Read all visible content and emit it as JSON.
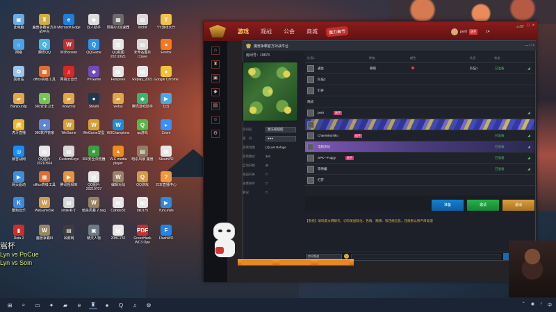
{
  "desktop": {
    "icons": [
      {
        "label": "此电脑",
        "glyph": "▣",
        "color": "#6ca9e7"
      },
      {
        "label": "魔兽争霸官方对战平台",
        "glyph": "♜",
        "color": "#d1ad40"
      },
      {
        "label": "Microsoft Edge",
        "glyph": "e",
        "color": "#1d7fd8"
      },
      {
        "label": "双人助手",
        "glyph": "◆",
        "color": "#ddd"
      },
      {
        "label": "网易UU加速器",
        "glyph": "▦",
        "color": "#6b6b6b"
      },
      {
        "label": "lolcbit",
        "glyph": "▤",
        "color": "#d8d8d8"
      },
      {
        "label": "YY游戏大厅",
        "glyph": "Y",
        "color": "#f2c24d"
      },
      {
        "label": "网络",
        "glyph": "⌂",
        "color": "#4fa1e7"
      },
      {
        "label": "腾讯QQ",
        "glyph": "Q",
        "color": "#45b5e9"
      },
      {
        "label": "W3Booster",
        "glyph": "W",
        "color": "#c12e2d"
      },
      {
        "label": "QQGame",
        "glyph": "Q",
        "color": "#2d93e6"
      },
      {
        "label": "QQ截图20210621",
        "glyph": "▥",
        "color": "#e6e6e6"
      },
      {
        "label": "未命名图片(1)ave",
        "glyph": "▤",
        "color": "#d8d8d8"
      },
      {
        "label": "Firefox",
        "glyph": "●",
        "color": "#f57a1c"
      },
      {
        "label": "回收站",
        "glyph": "♻",
        "color": "#9cc5ec"
      },
      {
        "label": "office高级工具",
        "glyph": "▦",
        "color": "#e06e2b"
      },
      {
        "label": "网易云音乐",
        "glyph": "♫",
        "color": "#d72727"
      },
      {
        "label": "VVGame",
        "glyph": "◆",
        "color": "#6f4bbc"
      },
      {
        "label": "Fenjoexe",
        "glyph": "▤",
        "color": "#e6e6e6"
      },
      {
        "label": "Replay_2021",
        "glyph": "▤",
        "color": "#e6e6e6"
      },
      {
        "label": "Google Chrome",
        "glyph": "●",
        "color": "#f0c436"
      },
      {
        "label": "Banjourxlp",
        "glyph": "▰",
        "color": "#e4a542"
      },
      {
        "label": "360安全卫士",
        "glyph": "●",
        "color": "#72c84c"
      },
      {
        "label": "wowzxip",
        "glyph": "▰",
        "color": "#e4a542"
      },
      {
        "label": "Steam",
        "glyph": "●",
        "color": "#22384e"
      },
      {
        "label": "webui",
        "glyph": "▰",
        "color": "#e4a542"
      },
      {
        "label": "腾讯游戏助手",
        "glyph": "◆",
        "color": "#39b66b"
      },
      {
        "label": "幻灯",
        "glyph": "▶",
        "color": "#49a8e7"
      },
      {
        "label": "虎牙直播",
        "glyph": "虎",
        "color": "#f5b51f"
      },
      {
        "label": "360软件管家",
        "glyph": "●",
        "color": "#5e84d6"
      },
      {
        "label": "WeGame",
        "glyph": "W",
        "color": "#d6a038"
      },
      {
        "label": "WeGame发型",
        "glyph": "W",
        "color": "#d6a038"
      },
      {
        "label": "W3Champions",
        "glyph": "W",
        "color": "#1f8dd6"
      },
      {
        "label": "qq游戏",
        "glyph": "Q",
        "color": "#56b849"
      },
      {
        "label": "Zoom",
        "glyph": "▸",
        "color": "#3b8ff6"
      },
      {
        "label": "暴雪战网",
        "glyph": "◎",
        "color": "#148eff"
      },
      {
        "label": "QQ图片20210504",
        "glyph": "▤",
        "color": "#e6e6e6"
      },
      {
        "label": "CustomKeys",
        "glyph": "▤",
        "color": "#d8d8d8"
      },
      {
        "label": "360安全浏览器",
        "glyph": "e",
        "color": "#3b9e40"
      },
      {
        "label": "VLC media player",
        "glyph": "▲",
        "color": "#ef8b18"
      },
      {
        "label": "暗杀风暴 魔兽",
        "glyph": "▤",
        "color": "#8f7e62"
      },
      {
        "label": "SteamVR",
        "glyph": "▤",
        "color": "#e6e6e6"
      },
      {
        "label": "网页驱动",
        "glyph": "▶",
        "color": "#3f8edc"
      },
      {
        "label": "office高级工具",
        "glyph": "▦",
        "color": "#e06e2b"
      },
      {
        "label": "腾讯视频库",
        "glyph": "▶",
        "color": "#e5963c"
      },
      {
        "label": "QQ图片20210707",
        "glyph": "▤",
        "color": "#e6e6e6"
      },
      {
        "label": "编辑对战",
        "glyph": "W",
        "color": "#9a856a"
      },
      {
        "label": "QQ游戏",
        "glyph": "Q",
        "color": "#d39b49"
      },
      {
        "label": "日本直播中心",
        "glyph": "?",
        "color": "#f2973d"
      },
      {
        "label": "酷狗音乐",
        "glyph": "K",
        "color": "#3a89e3"
      },
      {
        "label": "WeGameSki",
        "glyph": "W",
        "color": "#d39b49"
      },
      {
        "label": "smile补丁",
        "glyph": "▤",
        "color": "#d6d6d6"
      },
      {
        "label": "暗杀风暴 2.neg",
        "glyph": "W",
        "color": "#968163"
      },
      {
        "label": "Cahkle32",
        "glyph": "▤",
        "color": "#e6e6e6"
      },
      {
        "label": "dk0175",
        "glyph": "▤",
        "color": "#e6e6e6"
      },
      {
        "label": "YunLeWe",
        "glyph": "▶",
        "color": "#2f88d8"
      },
      {
        "label": "Dota 2",
        "glyph": "▮",
        "color": "#cb2e2c"
      },
      {
        "label": "魔兽争霸III",
        "glyph": "W",
        "color": "#9b865e"
      },
      {
        "label": "吊蔗网",
        "glyph": "▤",
        "color": "#3d3d3d"
      },
      {
        "label": "精灵人物",
        "glyph": "▣",
        "color": "#6e7a87"
      },
      {
        "label": "20BC732",
        "glyph": "▤",
        "color": "#e8e8e8"
      },
      {
        "label": "GreenHack WC3 Ope",
        "glyph": "PDF",
        "color": "#cb2d2d"
      },
      {
        "label": "FlashWO",
        "glyph": "F",
        "color": "#1f85ea"
      }
    ]
  },
  "app": {
    "nav": {
      "game": "游戏",
      "watch": "观战",
      "guild": "公会",
      "mall": "商城"
    },
    "event_badge": "魔力春节",
    "profile": {
      "name": "per0",
      "vip": "选手",
      "network": "47ms",
      "level": "14"
    },
    "window_buttons": [
      "—",
      "□",
      "×"
    ]
  },
  "room": {
    "title": "魔兽争霸官方对战平台",
    "room_number": "房间号：19873",
    "info_rows": [
      {
        "key": "房间名",
        "value": "魔法擂擂擂"
      },
      {
        "key": "密　码",
        "value": "●●●"
      },
      {
        "key": "游戏地图",
        "value": "(2)Last Refuge"
      },
      {
        "key": "游戏模式",
        "value": "1v1"
      },
      {
        "key": "自动开始",
        "value": "⊘"
      },
      {
        "key": "观战开关",
        "value": "□"
      },
      {
        "key": "录像保存",
        "value": "□"
      },
      {
        "key": "解说",
        "value": "□"
      }
    ],
    "columns": {
      "team": "队伍1",
      "race": "种族",
      "color": "颜色",
      "group": "队伍",
      "status": "状态"
    },
    "slots": [
      {
        "name": "通生",
        "race": "暴躁",
        "color": "",
        "team": "队伍1",
        "status": "已准备",
        "signal": "◢"
      },
      {
        "name": "打开",
        "race": "",
        "color": "",
        "team": "",
        "status": "",
        "signal": ""
      },
      {
        "name": "per0",
        "race": "",
        "color": "",
        "team": "",
        "status": "",
        "signal": "◢"
      },
      {
        "name": "",
        "race": "",
        "color": "",
        "team": "",
        "status": "",
        "signal": ""
      },
      {
        "name": "Chaemikomiko",
        "race": "",
        "color": "",
        "team": "",
        "status": "已准备",
        "signal": "◢"
      },
      {
        "name": "电脑测试",
        "race": "",
        "color": "",
        "team": "",
        "status": "已准备",
        "signal": "◢"
      },
      {
        "name": "SPK—Foggy",
        "race": "",
        "color": "",
        "team": "",
        "status": "已准备",
        "signal": "◢"
      },
      {
        "name": "等待编",
        "race": "",
        "color": "",
        "team": "",
        "status": "已准备",
        "signal": "◢"
      },
      {
        "name": "打开",
        "race": "",
        "color": "",
        "team": "",
        "status": "",
        "signal": ""
      }
    ],
    "buttons": {
      "ready": "准备",
      "invite": "邀请",
      "quit": "退出"
    },
    "notice": "【系统】请玩家文明聊天，切勿发送政治、色情、赌博、等违规信息，违规者以将严肃处理",
    "chat_channel": "房间频道",
    "send": "发送"
  },
  "overlay": {
    "line1": "嵩杯",
    "line2": "Lyn vs PoCue",
    "line3": "Lyn vs Soin"
  },
  "taskbar": {
    "start": "⊞",
    "search": "⌕",
    "tray_time": "中"
  }
}
